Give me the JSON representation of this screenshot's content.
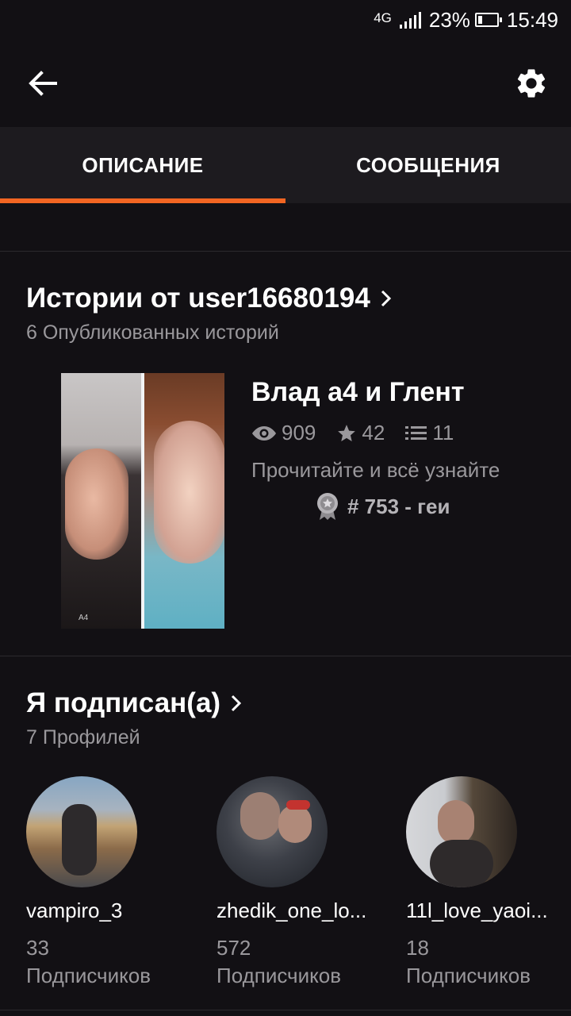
{
  "status": {
    "network": "4G",
    "battery": "23%",
    "battery_level": 0.23,
    "time": "15:49",
    "signal_icon": "signal-bars-icon",
    "battery_icon": "battery-icon"
  },
  "appbar": {
    "back_icon": "arrow-left-icon",
    "settings_icon": "gear-icon"
  },
  "tabs": [
    {
      "label": "ОПИСАНИЕ",
      "active": true
    },
    {
      "label": "СООБЩЕНИЯ",
      "active": false
    }
  ],
  "accent_color": "#f26522",
  "stories": {
    "title": "Истории от user16680194",
    "subtitle": "6 Опубликованных историй",
    "items": [
      {
        "title": "Влад а4 и Глент",
        "views": "909",
        "votes": "42",
        "parts": "11",
        "description": "Прочитайте и всё узнайте",
        "rank": "# 753 - геи",
        "cover_caption": "A4"
      }
    ]
  },
  "following": {
    "title": "Я подписан(а)",
    "subtitle": "7 Профилей",
    "profiles": [
      {
        "name": "vampiro_3",
        "count": "33",
        "label": "Подписчиков"
      },
      {
        "name": "zhedik_one_lo...",
        "count": "572",
        "label": "Подписчиков"
      },
      {
        "name": "11l_love_yaoi...",
        "count": "18",
        "label": "Подписчиков"
      }
    ]
  }
}
